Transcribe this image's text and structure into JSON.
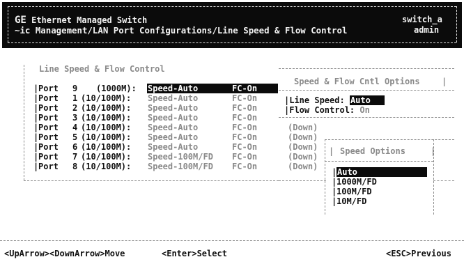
{
  "header": {
    "product_prefix": "GE",
    "product": "Ethernet Managed Switch",
    "breadcrumb": "~ic Management/LAN Port Configurations/Line Speed & Flow Control",
    "hostname": "switch_a",
    "user": "admin"
  },
  "main": {
    "title": "Line Speed & Flow Control",
    "port_label": "Port",
    "ports": [
      {
        "num": "9",
        "rate": "(1000M):",
        "speed": "Speed-Auto",
        "fc": "FC-On",
        "status": "",
        "selected": true
      },
      {
        "num": "1",
        "rate": "(10/100M):",
        "speed": "Speed-Auto",
        "fc": "FC-On",
        "status": ""
      },
      {
        "num": "2",
        "rate": "(10/100M):",
        "speed": "Speed-Auto",
        "fc": "FC-On",
        "status": ""
      },
      {
        "num": "3",
        "rate": "(10/100M):",
        "speed": "Speed-Auto",
        "fc": "FC-On",
        "status": ""
      },
      {
        "num": "4",
        "rate": "(10/100M):",
        "speed": "Speed-Auto",
        "fc": "FC-On",
        "status": "(Down)"
      },
      {
        "num": "5",
        "rate": "(10/100M):",
        "speed": "Speed-Auto",
        "fc": "FC-On",
        "status": "(Down)"
      },
      {
        "num": "6",
        "rate": "(10/100M):",
        "speed": "Speed-Auto",
        "fc": "FC-On",
        "status": "(Down)"
      },
      {
        "num": "7",
        "rate": "(10/100M):",
        "speed": "Speed-100M/FD",
        "fc": "FC-On",
        "status": "(Down)"
      },
      {
        "num": "8",
        "rate": "(10/100M):",
        "speed": "Speed-100M/FD",
        "fc": "FC-On",
        "status": "(Down)"
      }
    ]
  },
  "cntl_panel": {
    "title": "Speed & Flow Cntl Options",
    "line_speed_label": "Line Speed:",
    "line_speed_value": "Auto",
    "flow_control_label": "Flow Control:",
    "flow_control_value": "On"
  },
  "speed_options": {
    "title": "Speed Options",
    "options": [
      "Auto",
      "1000M/FD",
      "100M/FD",
      "10M/FD"
    ],
    "selected": "Auto"
  },
  "footer": {
    "move": "<UpArrow><DownArrow>Move",
    "select": "<Enter>Select",
    "previous": "<ESC>Previous"
  }
}
